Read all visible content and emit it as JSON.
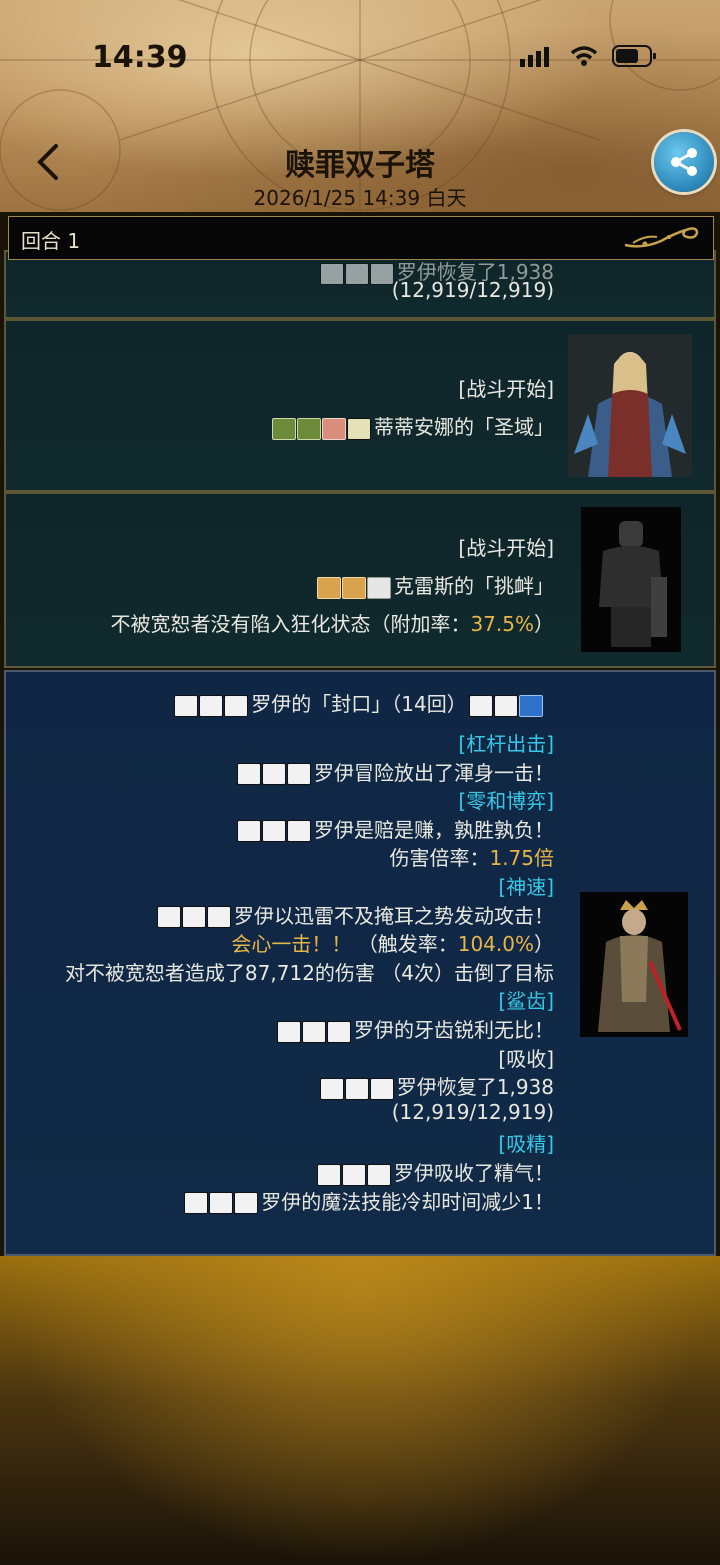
{
  "status": {
    "time": "14:39"
  },
  "header": {
    "title": "赎罪双子塔",
    "subtitle": "2026/1/25 14:39 白天"
  },
  "round": {
    "label": "回合 1"
  },
  "card0": {
    "partial_text": "罗伊恢复了1,938",
    "hp": "(12,919/12,919)"
  },
  "card1": {
    "tag": "[战斗开始]",
    "text": "蒂蒂安娜的「圣域」",
    "icons": [
      "green-cross",
      "green-cross",
      "orange-arrow",
      "white-cross"
    ]
  },
  "card2": {
    "tag": "[战斗开始]",
    "text": "克雷斯的「挑衅」",
    "detail_prefix": "不被宽恕者没有陷入狂化状态（附加率：",
    "detail_value": "37.5%",
    "detail_suffix": "）"
  },
  "card3": {
    "header_text": "罗伊的「封口」（14回）",
    "lines": [
      {
        "kind": "tag",
        "text": "[杠杆出击]"
      },
      {
        "kind": "msg",
        "text": "罗伊冒险放出了渾身一击！"
      },
      {
        "kind": "tag",
        "text": "[零和博弈]"
      },
      {
        "kind": "msg",
        "text": "罗伊是赔是赚，孰胜孰负！"
      },
      {
        "kind": "rate",
        "label": "伤害倍率：",
        "value": "1.75倍"
      },
      {
        "kind": "tag",
        "text": "[神速]"
      },
      {
        "kind": "msg",
        "text": "罗伊以迅雷不及掩耳之势发动攻击！"
      },
      {
        "kind": "crit",
        "label": "会心一击！！",
        "prefix": "（触发率：",
        "value": "104.0%",
        "suffix": "）"
      },
      {
        "kind": "plain",
        "text": "对不被宽恕者造成了87,712的伤害 （4次）击倒了目标"
      },
      {
        "kind": "tag",
        "text": "[鲨齿]"
      },
      {
        "kind": "msg",
        "text": "罗伊的牙齿锐利无比！"
      },
      {
        "kind": "plain",
        "text": "[吸收]"
      },
      {
        "kind": "msg",
        "text": "罗伊恢复了1,938"
      },
      {
        "kind": "plain",
        "text": "(12,919/12,919)"
      },
      {
        "kind": "tag",
        "text": "[吸精]"
      },
      {
        "kind": "msg",
        "text": "罗伊吸收了精气！"
      },
      {
        "kind": "msg",
        "text": "罗伊的魔法技能冷却时间减少1！"
      }
    ]
  },
  "colors": {
    "accent_cyan": "#37c8e6",
    "accent_gold": "#e8b548",
    "card_teal": "#10252a",
    "card_blue": "#0f2744"
  }
}
